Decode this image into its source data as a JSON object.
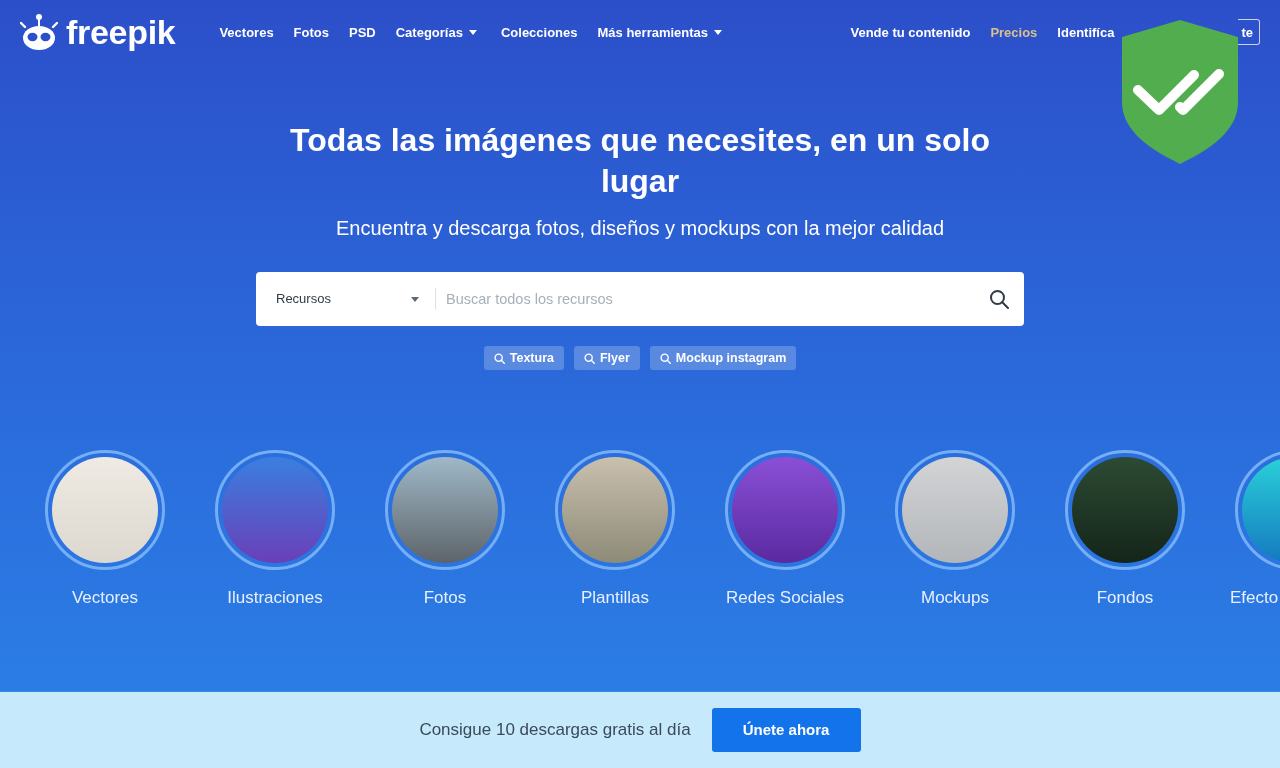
{
  "nav": {
    "logo": "freepik",
    "links": [
      {
        "label": "Vectores",
        "dropdown": false
      },
      {
        "label": "Fotos",
        "dropdown": false
      },
      {
        "label": "PSD",
        "dropdown": false
      },
      {
        "label": "Categorías",
        "dropdown": true
      },
      {
        "label": "Colecciones",
        "dropdown": false
      },
      {
        "label": "Más herramientas",
        "dropdown": true
      }
    ],
    "right_links": [
      {
        "label": "Vende tu contenido",
        "kind": "link"
      },
      {
        "label": "Precios",
        "kind": "highlight"
      },
      {
        "label": "Identifíca",
        "kind": "link"
      }
    ],
    "register_button": "te"
  },
  "hero": {
    "title": "Todas las imágenes que necesites, en un solo lugar",
    "subtitle": "Encuentra y descarga fotos, diseños y mockups con la mejor calidad"
  },
  "search": {
    "category": "Recursos",
    "placeholder": "Buscar todos los recursos"
  },
  "suggestions": [
    "Textura",
    "Flyer",
    "Mockup instagram"
  ],
  "categories": [
    "Vectores",
    "Ilustraciones",
    "Fotos",
    "Plantillas",
    "Redes Sociales",
    "Mockups",
    "Fondos",
    "Efecto"
  ],
  "promo_bar": {
    "text": "Consigue 10 descargas gratis al día",
    "button": "Únete ahora"
  }
}
